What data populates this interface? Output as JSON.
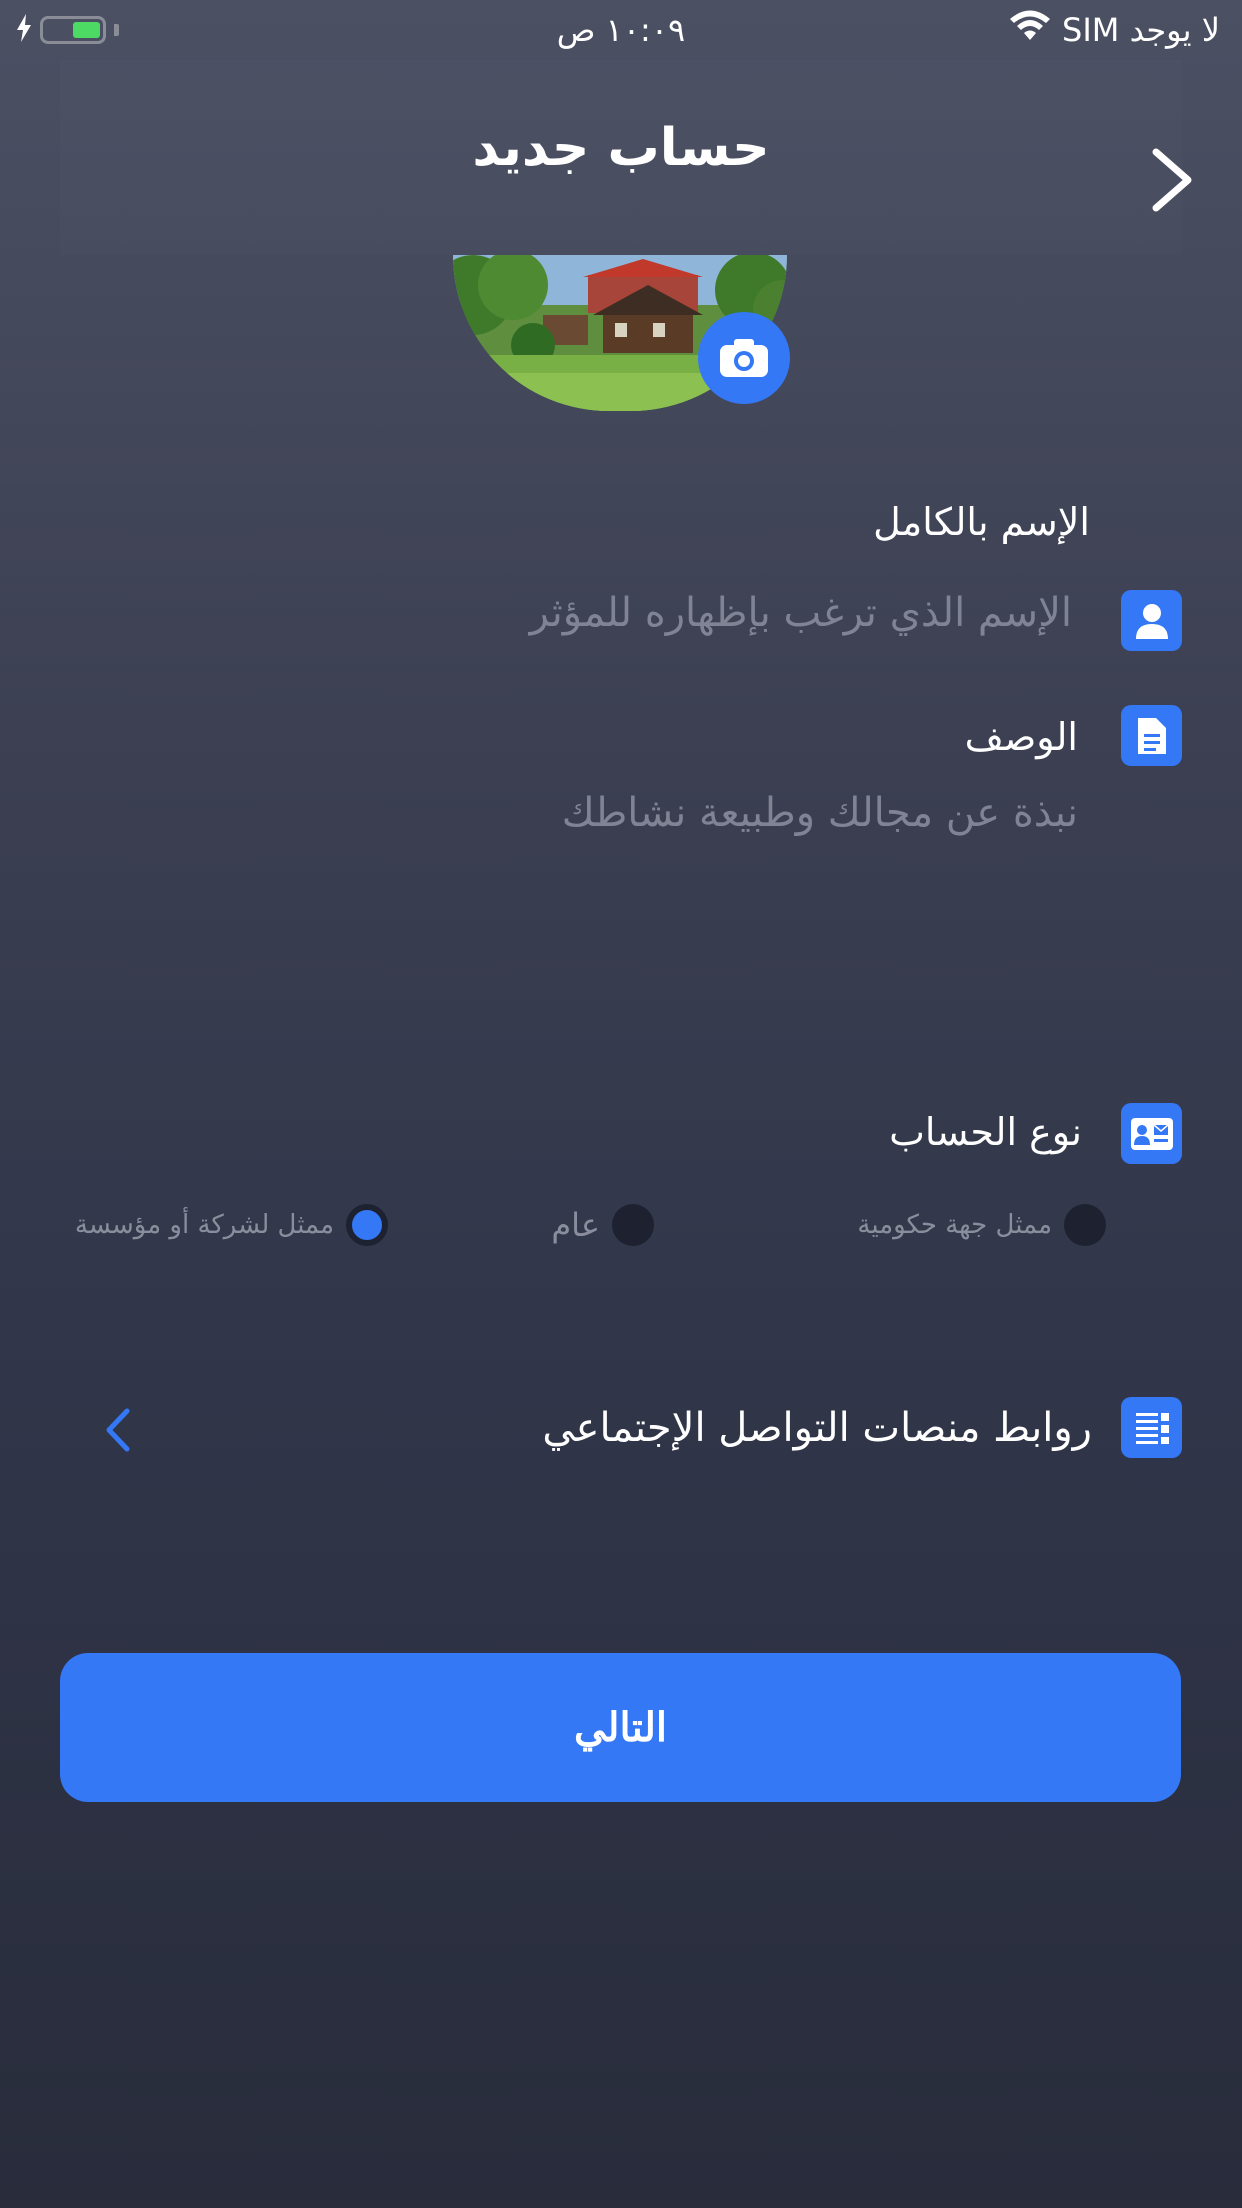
{
  "status_bar": {
    "carrier": "لا يوجد SIM",
    "time": "١٠:٠٩ ص",
    "battery_level": 0.5
  },
  "header": {
    "title": "حساب جديد",
    "back_icon": "chevron-right-icon"
  },
  "avatar": {
    "camera_icon": "camera-icon"
  },
  "form": {
    "full_name": {
      "label": "الإسم بالكامل",
      "placeholder": "الإسم الذي ترغب بإظهاره للمؤثر",
      "icon": "user-icon"
    },
    "description": {
      "label": "الوصف",
      "placeholder": "نبذة عن مجالك وطبيعة نشاطك",
      "icon": "document-icon"
    },
    "account_type": {
      "label": "نوع الحساب",
      "icon": "id-card-icon",
      "options": [
        {
          "label": "ممثل جهة حكومية",
          "selected": false
        },
        {
          "label": "عام",
          "selected": false
        },
        {
          "label": "ممثل لشركة أو مؤسسة",
          "selected": true
        }
      ]
    },
    "social_links": {
      "label": "روابط منصات التواصل الإجتماعي",
      "icon": "list-icon",
      "chevron_icon": "chevron-left-icon"
    }
  },
  "next_button": {
    "label": "التالي"
  },
  "colors": {
    "accent": "#3478f6",
    "background_top": "#4b5063",
    "background_bottom": "#282c3b",
    "placeholder": "#7f8394"
  }
}
